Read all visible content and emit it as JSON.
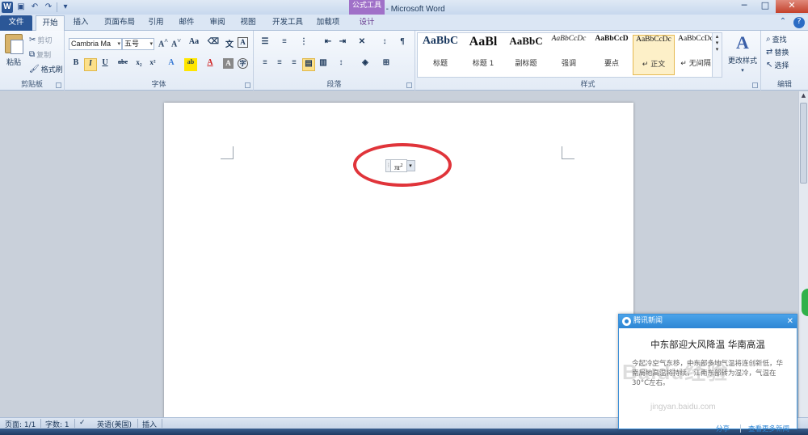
{
  "window": {
    "title": "文档1 - Microsoft Word",
    "context_tool": "公式工具",
    "controls": [
      "─",
      "□",
      "✕"
    ]
  },
  "tabs": [
    "文件",
    "开始",
    "插入",
    "页面布局",
    "引用",
    "邮件",
    "审阅",
    "视图",
    "开发工具",
    "加载项",
    "设计"
  ],
  "ribbon": {
    "clipboard": {
      "paste": "粘贴",
      "cut": "剪切",
      "copy": "复制",
      "format_painter": "格式刷",
      "label": "剪贴板"
    },
    "font": {
      "font_name": "Cambria Ma",
      "font_size": "五号",
      "label": "字体"
    },
    "paragraph": {
      "label": "段落"
    },
    "styles": {
      "items": [
        {
          "preview": "AaBbC",
          "name": "标题"
        },
        {
          "preview": "AaBl",
          "name": "标题 1"
        },
        {
          "preview": "AaBbC",
          "name": "副标题"
        },
        {
          "preview": "AaBbCcDc",
          "name": "强调"
        },
        {
          "preview": "AaBbCcD",
          "name": "要点"
        },
        {
          "preview": "AaBbCcDc",
          "name": "↵ 正文"
        },
        {
          "preview": "AaBbCcDc",
          "name": "↵ 无间隔"
        }
      ],
      "change_styles": "更改样式",
      "label": "样式"
    },
    "editing": {
      "find": "查找",
      "replace": "替换",
      "select": "选择",
      "label": "编辑"
    }
  },
  "document": {
    "equation": "πr",
    "equation_exponent": "2"
  },
  "statusbar": {
    "page": "页面: 1/1",
    "words": "字数: 1",
    "language": "英语(美国)",
    "mode": "插入"
  },
  "news_popup": {
    "source": "腾讯新闻",
    "headline": "中东部迎大风降温 华南高温",
    "body": "今起冷空气东移，中东部多地气温将连创新低，华南局地高温将持续，江南东部转为湿冷，气温在30°C左右。",
    "share": "分享",
    "more": "查看更多新闻"
  },
  "watermark": {
    "text": "Baidu经验",
    "url": "jingyan.baidu.com"
  },
  "colors": {
    "file_tab": "#2b5797",
    "context_tool": "#a070c8",
    "highlight_circle": "#e0343a",
    "news_header": "#2d86d4"
  }
}
